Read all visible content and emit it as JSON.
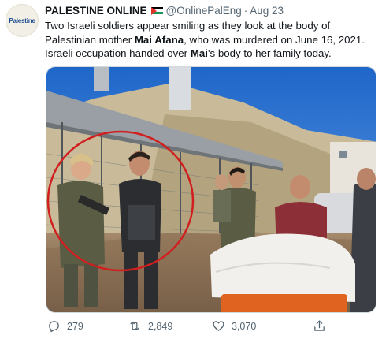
{
  "tweet": {
    "avatar_text": "Palestine",
    "author_name": "PALESTINE ONLINE",
    "author_handle": "@OnlinePalEng",
    "separator": "·",
    "date": "Aug 23",
    "text_part1": "Two Israeli soldiers appear smiling as they look at the body of Palestinian mother ",
    "text_bold1": "Mai Afana",
    "text_part2": ", who was murdered on June 16, 2021.",
    "text_part3": "Israeli occupation handed over ",
    "text_bold2": "Mai",
    "text_part4": "'s body to her family today.",
    "replies": "279",
    "retweets": "2,849",
    "likes": "3,070"
  },
  "icons": {
    "avatar": "palestine-online-logo",
    "flag": "palestine-flag-emoji",
    "reply": "reply-icon",
    "retweet": "retweet-icon",
    "like": "heart-icon",
    "share": "share-icon"
  },
  "colors": {
    "text": "#0f1419",
    "secondary": "#536471",
    "annotation_circle": "#d11f1f"
  }
}
